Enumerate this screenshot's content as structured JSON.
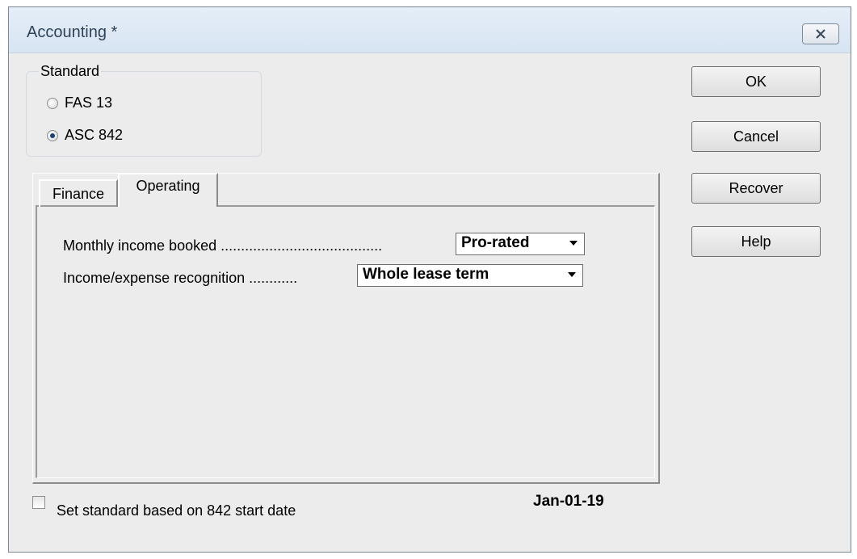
{
  "window": {
    "title": "Accounting *"
  },
  "standard": {
    "label": "Standard",
    "options": [
      {
        "label": "FAS 13",
        "checked": false
      },
      {
        "label": "ASC 842",
        "checked": true
      }
    ]
  },
  "buttons": {
    "ok": "OK",
    "cancel": "Cancel",
    "recover": "Recover",
    "help": "Help"
  },
  "tabs": [
    {
      "label": "Finance",
      "active": false
    },
    {
      "label": "Operating",
      "active": true
    }
  ],
  "operating": {
    "monthly_income_label": "Monthly income booked ........................................",
    "monthly_income_value": "Pro-rated",
    "recognition_label": "Income/expense recognition ............",
    "recognition_value": "Whole lease term"
  },
  "footer": {
    "checkbox_label": "Set standard based on 842 start date",
    "checkbox_checked": false,
    "date": "Jan-01-19"
  }
}
